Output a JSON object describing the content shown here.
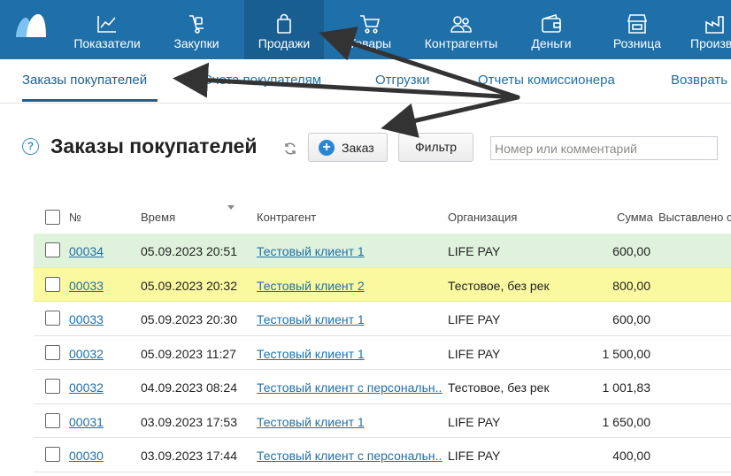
{
  "colors": {
    "nav_bg": "#1f6fa8",
    "nav_active": "#185e91",
    "link": "#1f6fa8",
    "row_green": "#dff2dc",
    "row_yellow": "#fbf9a0"
  },
  "topnav": {
    "items": [
      {
        "label": "Показатели",
        "icon": "chart-icon"
      },
      {
        "label": "Закупки",
        "icon": "cart-dolly-icon"
      },
      {
        "label": "Продажи",
        "icon": "shopping-bag-icon"
      },
      {
        "label": "Товары",
        "icon": "shopping-cart-icon"
      },
      {
        "label": "Контрагенты",
        "icon": "people-icon"
      },
      {
        "label": "Деньги",
        "icon": "wallet-icon"
      },
      {
        "label": "Розница",
        "icon": "store-icon"
      },
      {
        "label": "Произв",
        "icon": "factory-icon"
      }
    ]
  },
  "subnav": {
    "items": [
      "Заказы покупателей",
      "Счета покупателям",
      "Отгрузки",
      "Отчеты комиссионера",
      "Возврать"
    ]
  },
  "header": {
    "help": "?",
    "title": "Заказы покупателей",
    "order_button": "Заказ",
    "order_plus": "+",
    "filter_button": "Фильтр",
    "search_placeholder": "Номер или комментарий"
  },
  "table": {
    "columns": [
      "№",
      "Время",
      "Контрагент",
      "Организация",
      "Сумма",
      "Выставлено с"
    ],
    "rows": [
      {
        "num": "00034",
        "time": "05.09.2023 20:51",
        "client": "Тестовый клиент 1",
        "org": "LIFE PAY",
        "sum": "600,00",
        "highlight": "green"
      },
      {
        "num": "00033",
        "time": "05.09.2023 20:32",
        "client": "Тестовый клиент 2",
        "org": "Тестовое, без рек",
        "sum": "800,00",
        "highlight": "yellow"
      },
      {
        "num": "00033",
        "time": "05.09.2023 20:30",
        "client": "Тестовый клиент 1",
        "org": "LIFE PAY",
        "sum": "600,00",
        "highlight": "none"
      },
      {
        "num": "00032",
        "time": "05.09.2023 11:27",
        "client": "Тестовый клиент 1",
        "org": "LIFE PAY",
        "sum": "1 500,00",
        "highlight": "none"
      },
      {
        "num": "00032",
        "time": "04.09.2023 08:24",
        "client": "Тестовый клиент с персональн...",
        "org": "Тестовое, без рек",
        "sum": "1 001,83",
        "highlight": "none"
      },
      {
        "num": "00031",
        "time": "03.09.2023 17:53",
        "client": "Тестовый клиент 1",
        "org": "LIFE PAY",
        "sum": "1 650,00",
        "highlight": "none"
      },
      {
        "num": "00030",
        "time": "03.09.2023 17:44",
        "client": "Тестовый клиент с персональн...",
        "org": "LIFE PAY",
        "sum": "400,00",
        "highlight": "none"
      }
    ]
  }
}
